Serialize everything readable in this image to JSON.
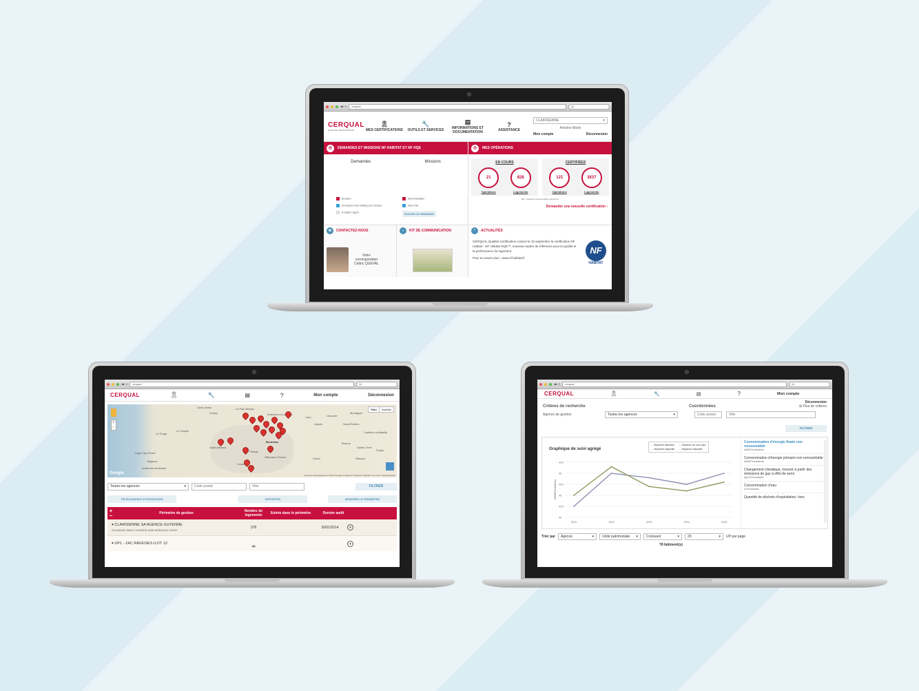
{
  "browser": {
    "url": "cerqual",
    "search": "Q•"
  },
  "brand": {
    "name": "CERQUAL",
    "tagline": "QUALITEL CERTIFICATION"
  },
  "top": {
    "nav": [
      {
        "label": "MES CERTIFICATIONS",
        "icon": "ribbon-icon"
      },
      {
        "label": "OUTILS ET SERVICES",
        "icon": "wrench-icon"
      },
      {
        "label": "INFORMATIONS ET DOCUMENTATION",
        "icon": "documents-icon"
      },
      {
        "label": "ASSISTANCE",
        "icon": "question-icon"
      }
    ],
    "org_select": "CLAIRSIENNE",
    "user_name": "Antoine Marie",
    "account_link": "Mon compte",
    "logout_link": "Déconnexion",
    "demandes": {
      "title": "DEMANDES ET MISSIONS NF HABITAT ET NF HQE",
      "col1": "Demandes",
      "col2": "Missions",
      "legend": [
        {
          "label": "Brouillon",
          "color": "#c8103e"
        },
        {
          "label": "Envoyé(e) mais validé(e) par Cerqual",
          "color": "#3aa0d8"
        },
        {
          "label": "A valider l'agent",
          "color": "#dddddd"
        },
        {
          "label": "Auto-évaluation",
          "color": "#c8103e"
        },
        {
          "label": "Auto-CVA",
          "color": "#3aa0d8"
        }
      ],
      "new_button": "NOUVELLE DEMANDE"
    },
    "operations": {
      "title": "MES OPÉRATIONS",
      "en_cours": "EN COURS",
      "certifiees": "CERTIFIÉES",
      "stats": [
        {
          "value": "21",
          "label": "Opérations"
        },
        {
          "value": "828",
          "label": "Logements"
        },
        {
          "value": "121",
          "label": "Opérations"
        },
        {
          "value": "3837",
          "label": "Logements"
        }
      ],
      "note": "NB : opérations depuis 2006 uniquement",
      "request_link": "Demander une nouvelle certification"
    },
    "contact": {
      "title": "CONTACTEZ-NOUS",
      "line1": "Votre",
      "line2": "correspondant",
      "line3": "Cédric QUEVAL"
    },
    "kit": {
      "title": "KIT DE COMMUNICATION"
    },
    "news": {
      "title": "ACTUALITÉS",
      "body": "CERQUAL Qualitel Certification a lancé le 15 septembre la certification NF Habitat - NF Habitat HQE™, nouveau repère de référence pour la qualité et la performance du logement.",
      "more": "Pour en savoir plus : www.nf-habitat.fr",
      "badge": "NF",
      "badge_sub": "HABITAT"
    }
  },
  "left": {
    "nav_account": "Mon compte",
    "nav_logout": "Déconnexion",
    "map": {
      "plan": "Plan",
      "satellite": "Satellite",
      "places": [
        "Saint-Vivien",
        "Soulac",
        "Le Pian-Médoc",
        "Ambarès-et-Lagrave",
        "Libourne",
        "Montagne",
        "Saint-Émilion",
        "Le Porge",
        "Le Temple",
        "Izon",
        "Vayres",
        "Bordeaux",
        "Pessac",
        "Villenave-d'Ornon",
        "Créon",
        "Branne",
        "Castillon-la-Bataille",
        "Sainte-Terre",
        "Pujols",
        "Rauzan",
        "Lège-Cap-Ferret",
        "Biganos",
        "Andernos-les-Bains",
        "Cestas",
        "Saint-Médard"
      ],
      "attribution": "Données cartographiques ©2014 Google   Conditions d'utilisation   Signaler une erreur cartographique"
    },
    "filter": {
      "agency": "Toutes les agences",
      "postal_placeholder": "Code postal",
      "city_placeholder": "Ville",
      "button": "FILTRER"
    },
    "actions": {
      "download": "TÉLÉCHARGER ATTESTATIONS",
      "export": "EXPORTER",
      "modify": "MODIFIER LE PÉRIMÈTRE"
    },
    "table": {
      "headers": [
        "Périmètre de gestion",
        "Nombre de logements",
        "Entrée dans le périmètre",
        "Dernier audit"
      ],
      "rows": [
        {
          "name": "CLAIRSIENNE SA AGENCE GUYENNE",
          "address": "223 AVENUE EMILE COUNORD 33081 BORDEAUX CEDEX",
          "count": "378",
          "entry": "",
          "audit": "30/01/2014"
        },
        {
          "name": "UP1 - ZAC RAVESIES ILOT 13",
          "address": "",
          "count": "44",
          "entry": "",
          "audit": ""
        }
      ]
    }
  },
  "right": {
    "nav_account": "Mon compte",
    "nav_logout": "Déconnexion",
    "search_title": "Critères de recherche",
    "coords_title": "Coordonnées",
    "more_criteria": "Plus de critères",
    "agency_label": "Agence de gestion",
    "agency_value": "Toutes les agences",
    "postal_placeholder": "Code postal",
    "city_placeholder": "Ville",
    "filter_button": "FILTRER",
    "sort_label": "Trier par",
    "sort_field": "Agence",
    "sort_field2": "Unité patrimoniale",
    "sort_order": "Croissant",
    "per_page_value": "20",
    "per_page_label": "UP par page",
    "count": "78 bâtiment(s)",
    "indicators": [
      {
        "title": "Consommation d'énergie finale non renouvelable",
        "unit": "kWhEF/m²shab/an"
      },
      {
        "title": "Consommation d'énergie primaire non renouvelable",
        "unit": "kWhEP/m²shab/an"
      },
      {
        "title": "Changement climatique, mesuré à partir des émissions de gaz à effet de serre",
        "unit": "kgCO2/m²shab/an"
      },
      {
        "title": "Consommation d'eau",
        "unit": "m³/m²shab/an"
      },
      {
        "title": "Quantité de déchets d'exploitation, hors",
        "unit": ""
      }
    ]
  },
  "chart_data": {
    "type": "line",
    "title": "Graphique de suivi agrégé",
    "ylabel": "kWhEF/m²shab/an",
    "x": [
      "2011",
      "2012",
      "2013",
      "2014",
      "2015"
    ],
    "yticks": [
      "44",
      "44.5",
      "45",
      "45.5",
      "46",
      "46.5"
    ],
    "ylim": [
      44,
      46.5
    ],
    "legend": [
      "Moyenne sélection",
      "Moyenne de mon parc",
      "Moyenne régionale",
      "Moyenne nationale"
    ],
    "series": [
      {
        "name": "Moyenne sélection",
        "color": "#8a8fb0",
        "values": [
          44.5,
          46,
          45.8,
          45.5,
          46
        ]
      },
      {
        "name": "Moyenne régionale",
        "color": "#8a9a5b",
        "values": [
          45,
          46.3,
          45.4,
          45.2,
          45.6
        ]
      }
    ]
  }
}
